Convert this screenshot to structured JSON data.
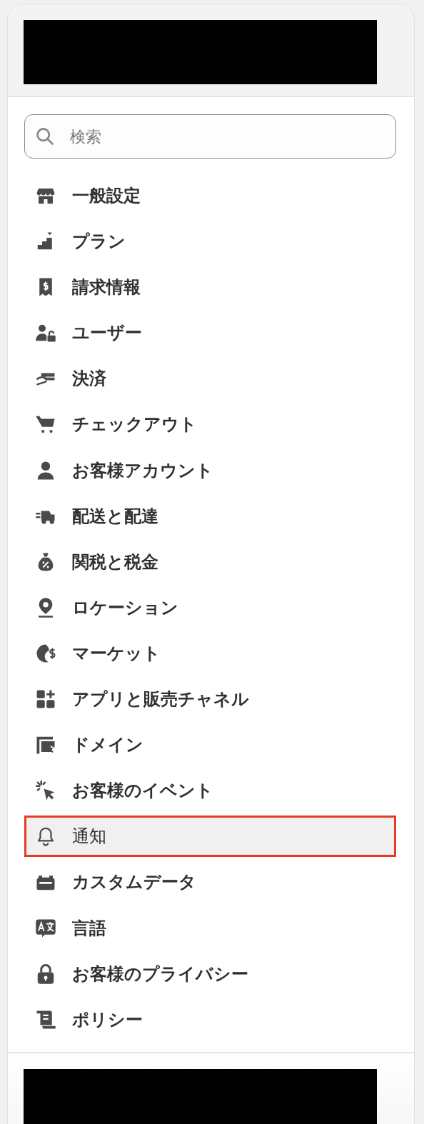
{
  "search": {
    "placeholder": "検索"
  },
  "nav": [
    {
      "label": "一般設定",
      "selected": false
    },
    {
      "label": "プラン",
      "selected": false
    },
    {
      "label": "請求情報",
      "selected": false
    },
    {
      "label": "ユーザー",
      "selected": false
    },
    {
      "label": "決済",
      "selected": false
    },
    {
      "label": "チェックアウト",
      "selected": false
    },
    {
      "label": "お客様アカウント",
      "selected": false
    },
    {
      "label": "配送と配達",
      "selected": false
    },
    {
      "label": "関税と税金",
      "selected": false
    },
    {
      "label": "ロケーション",
      "selected": false
    },
    {
      "label": "マーケット",
      "selected": false
    },
    {
      "label": "アプリと販売チャネル",
      "selected": false
    },
    {
      "label": "ドメイン",
      "selected": false
    },
    {
      "label": "お客様のイベント",
      "selected": false
    },
    {
      "label": "通知",
      "selected": true
    },
    {
      "label": "カスタムデータ",
      "selected": false
    },
    {
      "label": "言語",
      "selected": false
    },
    {
      "label": "お客様のプライバシー",
      "selected": false
    },
    {
      "label": "ポリシー",
      "selected": false
    }
  ]
}
